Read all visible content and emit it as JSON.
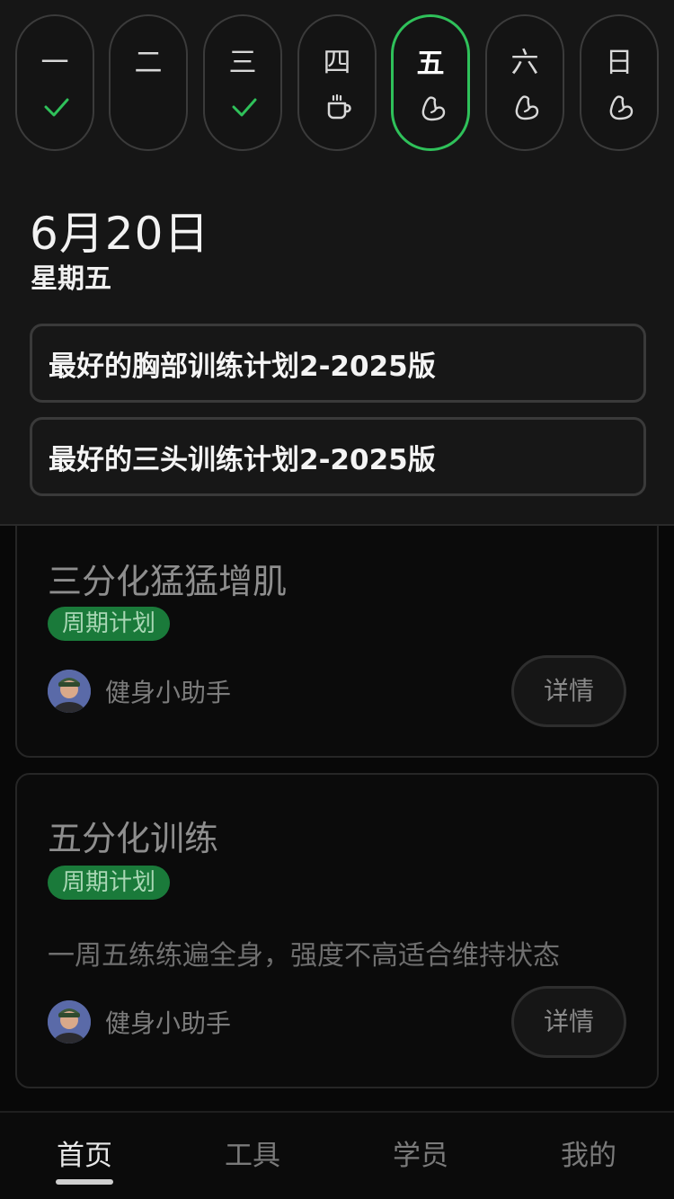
{
  "week": {
    "days": [
      {
        "label": "一",
        "status_icon": "check-icon"
      },
      {
        "label": "二",
        "status_icon": ""
      },
      {
        "label": "三",
        "status_icon": "check-icon"
      },
      {
        "label": "四",
        "status_icon": "coffee-icon"
      },
      {
        "label": "五",
        "status_icon": "flexed-arm-icon",
        "selected": true
      },
      {
        "label": "六",
        "status_icon": "flexed-arm-icon"
      },
      {
        "label": "日",
        "status_icon": "flexed-arm-icon"
      }
    ]
  },
  "header": {
    "date": "6月20日",
    "weekday": "星期五"
  },
  "today_plans": [
    "最好的胸部训练计划2-2025版",
    "最好的三头训练计划2-2025版"
  ],
  "cards": [
    {
      "title": "三分化猛猛增肌",
      "tag": "周期计划",
      "description": "",
      "author": "健身小助手",
      "detail_label": "详情"
    },
    {
      "title": "五分化训练",
      "tag": "周期计划",
      "description": "一周五练练遍全身，强度不高适合维持状态",
      "author": "健身小助手",
      "detail_label": "详情"
    }
  ],
  "tabs": [
    {
      "label": "首页",
      "active": true
    },
    {
      "label": "工具"
    },
    {
      "label": "学员"
    },
    {
      "label": "我的"
    }
  ],
  "colors": {
    "accent_green": "#2fc15a",
    "tag_green": "#1a7a3a",
    "background": "#080808",
    "panel": "#161616"
  }
}
